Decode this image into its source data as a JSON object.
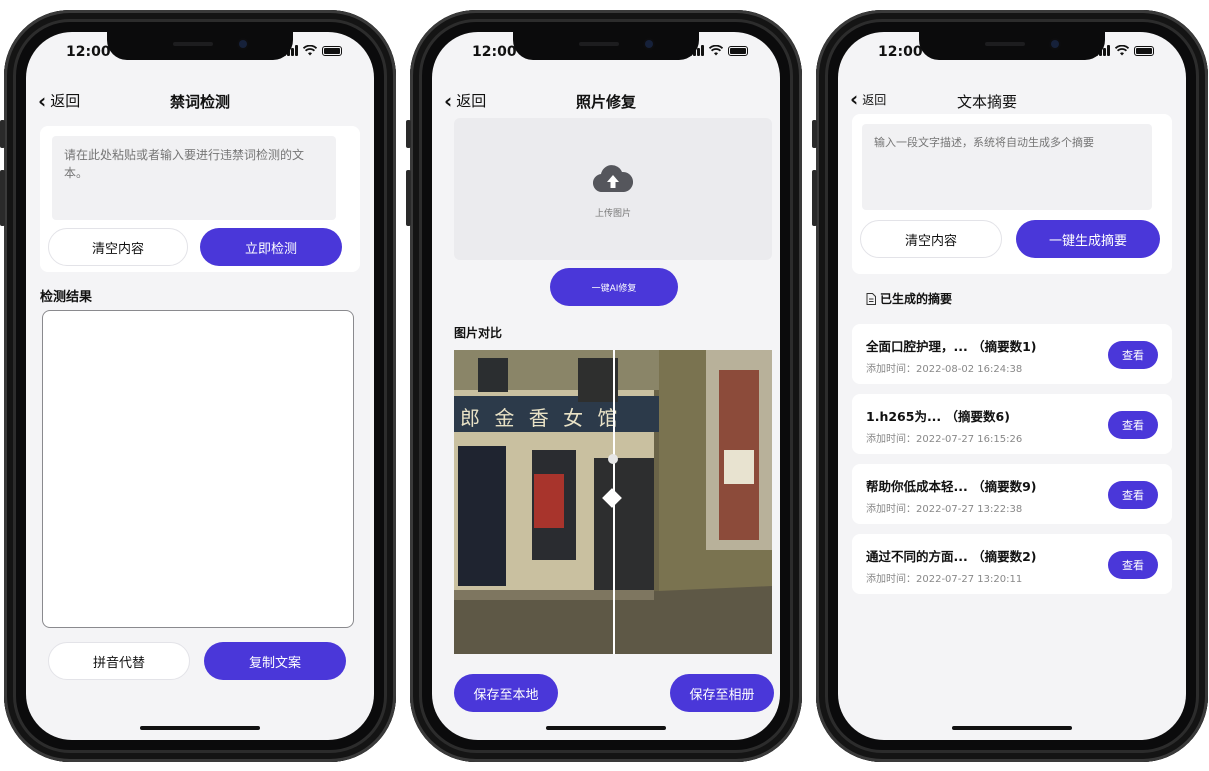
{
  "status_time": "12:00",
  "back_label": "返回",
  "screen1": {
    "title": "禁词检测",
    "input_placeholder": "请在此处粘贴或者输入要进行违禁词检测的文本。",
    "clear_label": "清空内容",
    "check_label": "立即检测",
    "result_label": "检测结果",
    "pinyin_label": "拼音代替",
    "copy_label": "复制文案"
  },
  "screen2": {
    "title": "照片修复",
    "upload_label": "上传图片",
    "repair_label": "一键AI修复",
    "compare_label": "图片对比",
    "shop_sign": "郎 金 香 女 馆",
    "compare_slider_position": 0.5,
    "save_local_label": "保存至本地",
    "save_album_label": "保存至相册"
  },
  "screen3": {
    "title": "文本摘要",
    "input_placeholder": "输入一段文字描述，系统将自动生成多个摘要",
    "clear_label": "清空内容",
    "generate_label": "一键生成摘要",
    "section_label": "已生成的摘要",
    "view_label": "查看",
    "items": [
      {
        "title": "全面口腔护理，... （摘要数1)",
        "time": "添加时间：2022-08-02 16:24:38"
      },
      {
        "title": "1.h265为... （摘要数6)",
        "time": "添加时间：2022-07-27 16:15:26"
      },
      {
        "title": "帮助你低成本轻... （摘要数9)",
        "time": "添加时间：2022-07-27 13:22:38"
      },
      {
        "title": "通过不同的方面... （摘要数2)",
        "time": "添加时间：2022-07-27 13:20:11"
      }
    ]
  },
  "colors": {
    "primary": "#4a37d9",
    "background": "#f4f4f6",
    "frame": "#0b0b0c"
  }
}
